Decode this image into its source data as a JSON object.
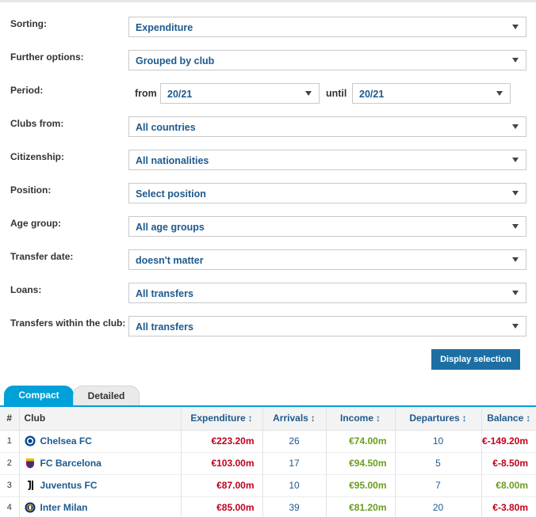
{
  "filters": [
    {
      "key": "sorting",
      "label": "Sorting:",
      "value": "Expenditure"
    },
    {
      "key": "further_options",
      "label": "Further options:",
      "value": "Grouped by club"
    },
    {
      "key": "clubs_from",
      "label": "Clubs from:",
      "value": "All countries"
    },
    {
      "key": "citizenship",
      "label": "Citizenship:",
      "value": "All nationalities"
    },
    {
      "key": "position",
      "label": "Position:",
      "value": "Select position"
    },
    {
      "key": "age_group",
      "label": "Age group:",
      "value": "All age groups"
    },
    {
      "key": "transfer_date",
      "label": "Transfer date:",
      "value": "doesn't matter"
    },
    {
      "key": "loans",
      "label": "Loans:",
      "value": "All transfers"
    },
    {
      "key": "within_club",
      "label": "Transfers within the club:",
      "value": "All transfers"
    }
  ],
  "period": {
    "label": "Period:",
    "from_label": "from",
    "from_value": "20/21",
    "until_label": "until",
    "until_value": "20/21"
  },
  "display_button": "Display selection",
  "tabs": {
    "compact": "Compact",
    "detailed": "Detailed"
  },
  "table": {
    "headers": {
      "num": "#",
      "club": "Club",
      "expenditure": "Expenditure",
      "arrivals": "Arrivals",
      "income": "Income",
      "departures": "Departures",
      "balance": "Balance"
    },
    "sort_glyph": "↕",
    "rows": [
      {
        "pos": "1",
        "club": "Chelsea FC",
        "crest": "chelsea-crest",
        "expenditure": "€223.20m",
        "arrivals": "26",
        "income": "€74.00m",
        "departures": "10",
        "balance": "€-149.20m",
        "balance_sign": "negative"
      },
      {
        "pos": "2",
        "club": "FC Barcelona",
        "crest": "barcelona-crest",
        "expenditure": "€103.00m",
        "arrivals": "17",
        "income": "€94.50m",
        "departures": "5",
        "balance": "€-8.50m",
        "balance_sign": "negative"
      },
      {
        "pos": "3",
        "club": "Juventus FC",
        "crest": "juventus-crest",
        "expenditure": "€87.00m",
        "arrivals": "10",
        "income": "€95.00m",
        "departures": "7",
        "balance": "€8.00m",
        "balance_sign": "positive"
      },
      {
        "pos": "4",
        "club": "Inter Milan",
        "crest": "inter-crest",
        "expenditure": "€85.00m",
        "arrivals": "39",
        "income": "€81.20m",
        "departures": "20",
        "balance": "€-3.80m",
        "balance_sign": "negative"
      }
    ]
  },
  "colors": {
    "accent": "#00a0d8",
    "button": "#1d6fa3",
    "link": "#1d5a8e",
    "negative": "#c0001b",
    "positive": "#689e1e"
  }
}
